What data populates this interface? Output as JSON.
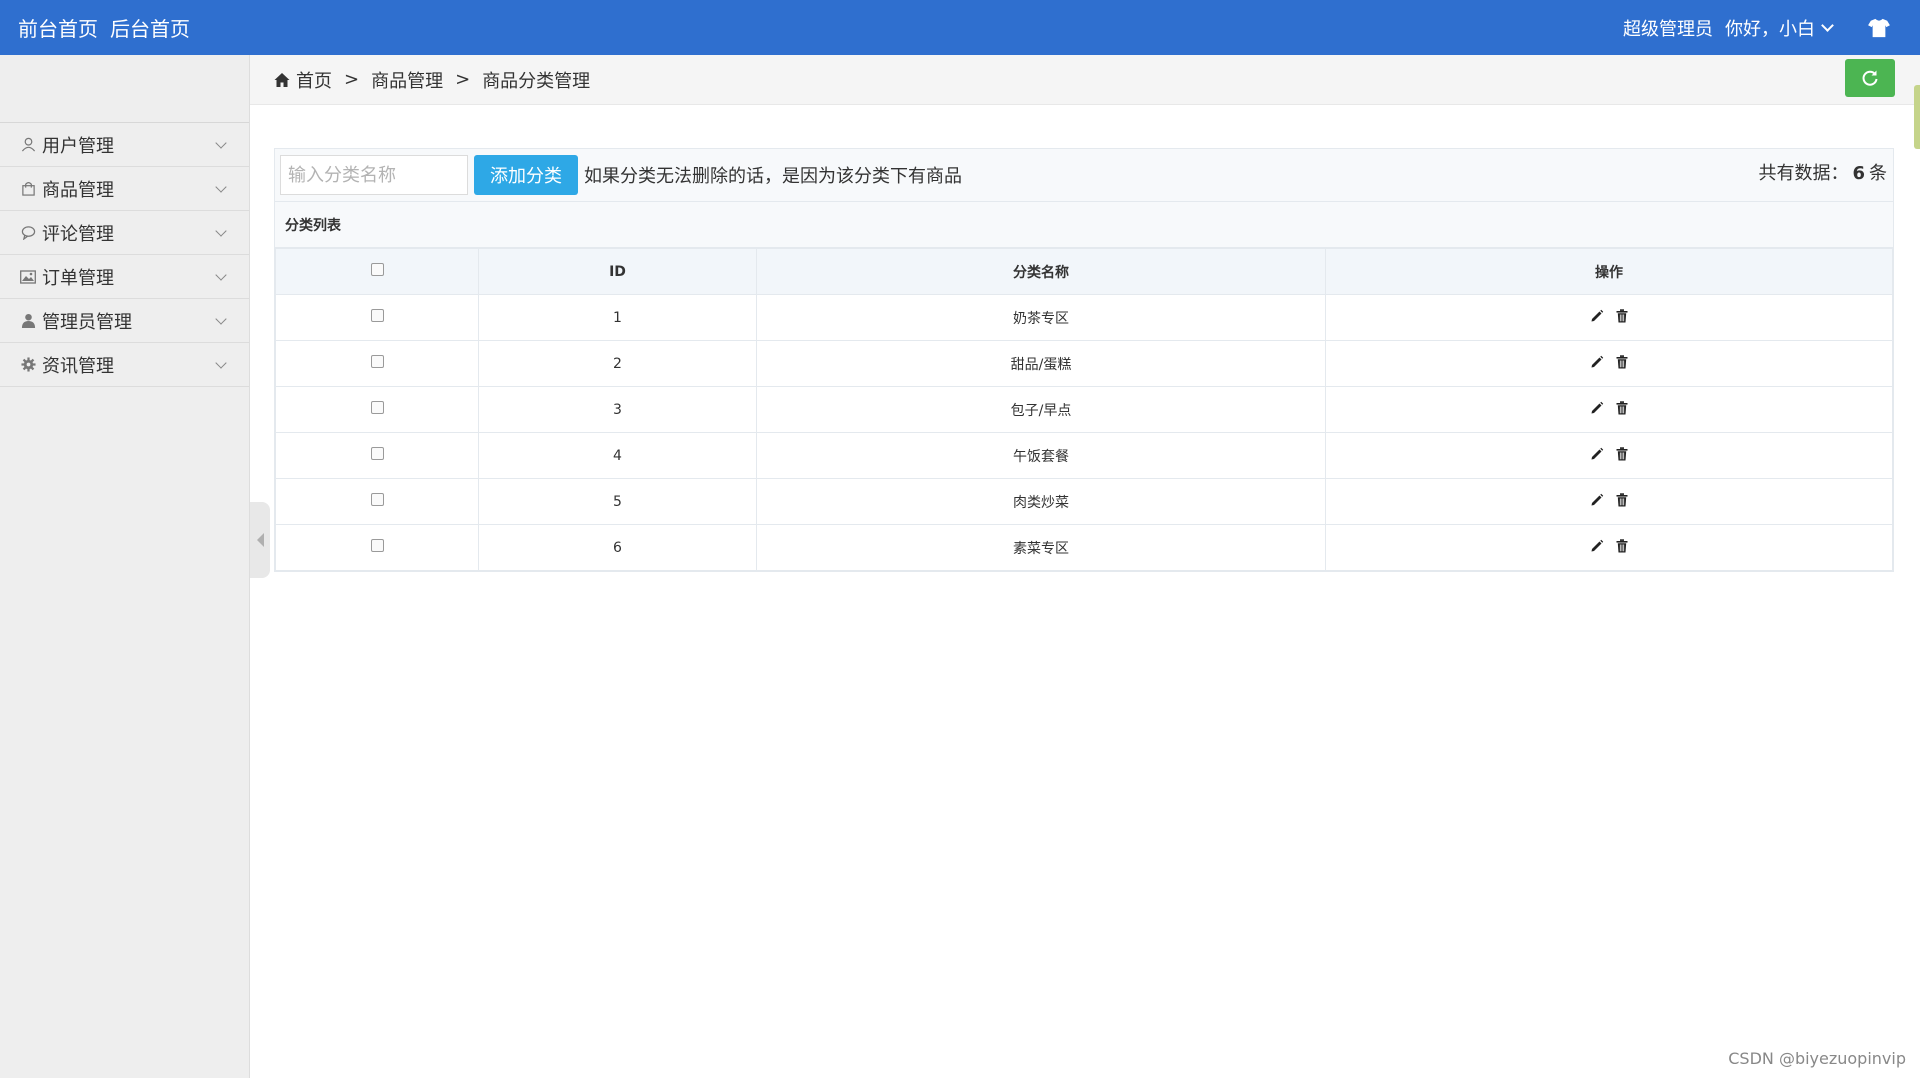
{
  "topbar": {
    "front_home": "前台首页",
    "back_home": "后台首页",
    "role": "超级管理员",
    "greeting": "你好，小白"
  },
  "sidebar": {
    "items": [
      {
        "label": "用户管理",
        "icon": "user-outline-icon"
      },
      {
        "label": "商品管理",
        "icon": "shopping-bag-icon"
      },
      {
        "label": "评论管理",
        "icon": "comment-icon"
      },
      {
        "label": "订单管理",
        "icon": "picture-icon"
      },
      {
        "label": "管理员管理",
        "icon": "user-solid-icon"
      },
      {
        "label": "资讯管理",
        "icon": "gear-icon"
      }
    ]
  },
  "breadcrumb": {
    "home": "首页",
    "sep": ">",
    "level1": "商品管理",
    "level2": "商品分类管理"
  },
  "toolbar": {
    "search_placeholder": "输入分类名称",
    "add_label": "添加分类",
    "hint": "如果分类无法删除的话，是因为该分类下有商品",
    "count_prefix": "共有数据：",
    "count_value": "6",
    "count_suffix": "条"
  },
  "table": {
    "title": "分类列表",
    "headers": {
      "id": "ID",
      "name": "分类名称",
      "ops": "操作"
    },
    "rows": [
      {
        "id": "1",
        "name": "奶茶专区"
      },
      {
        "id": "2",
        "name": "甜品/蛋糕"
      },
      {
        "id": "3",
        "name": "包子/早点"
      },
      {
        "id": "4",
        "name": "午饭套餐"
      },
      {
        "id": "5",
        "name": "肉类炒菜"
      },
      {
        "id": "6",
        "name": "素菜专区"
      }
    ]
  },
  "watermark": "CSDN @biyezuopinvip",
  "colors": {
    "topbar": "#2f6fcf",
    "add_button": "#2ea8e6",
    "refresh_button": "#4cb552"
  }
}
